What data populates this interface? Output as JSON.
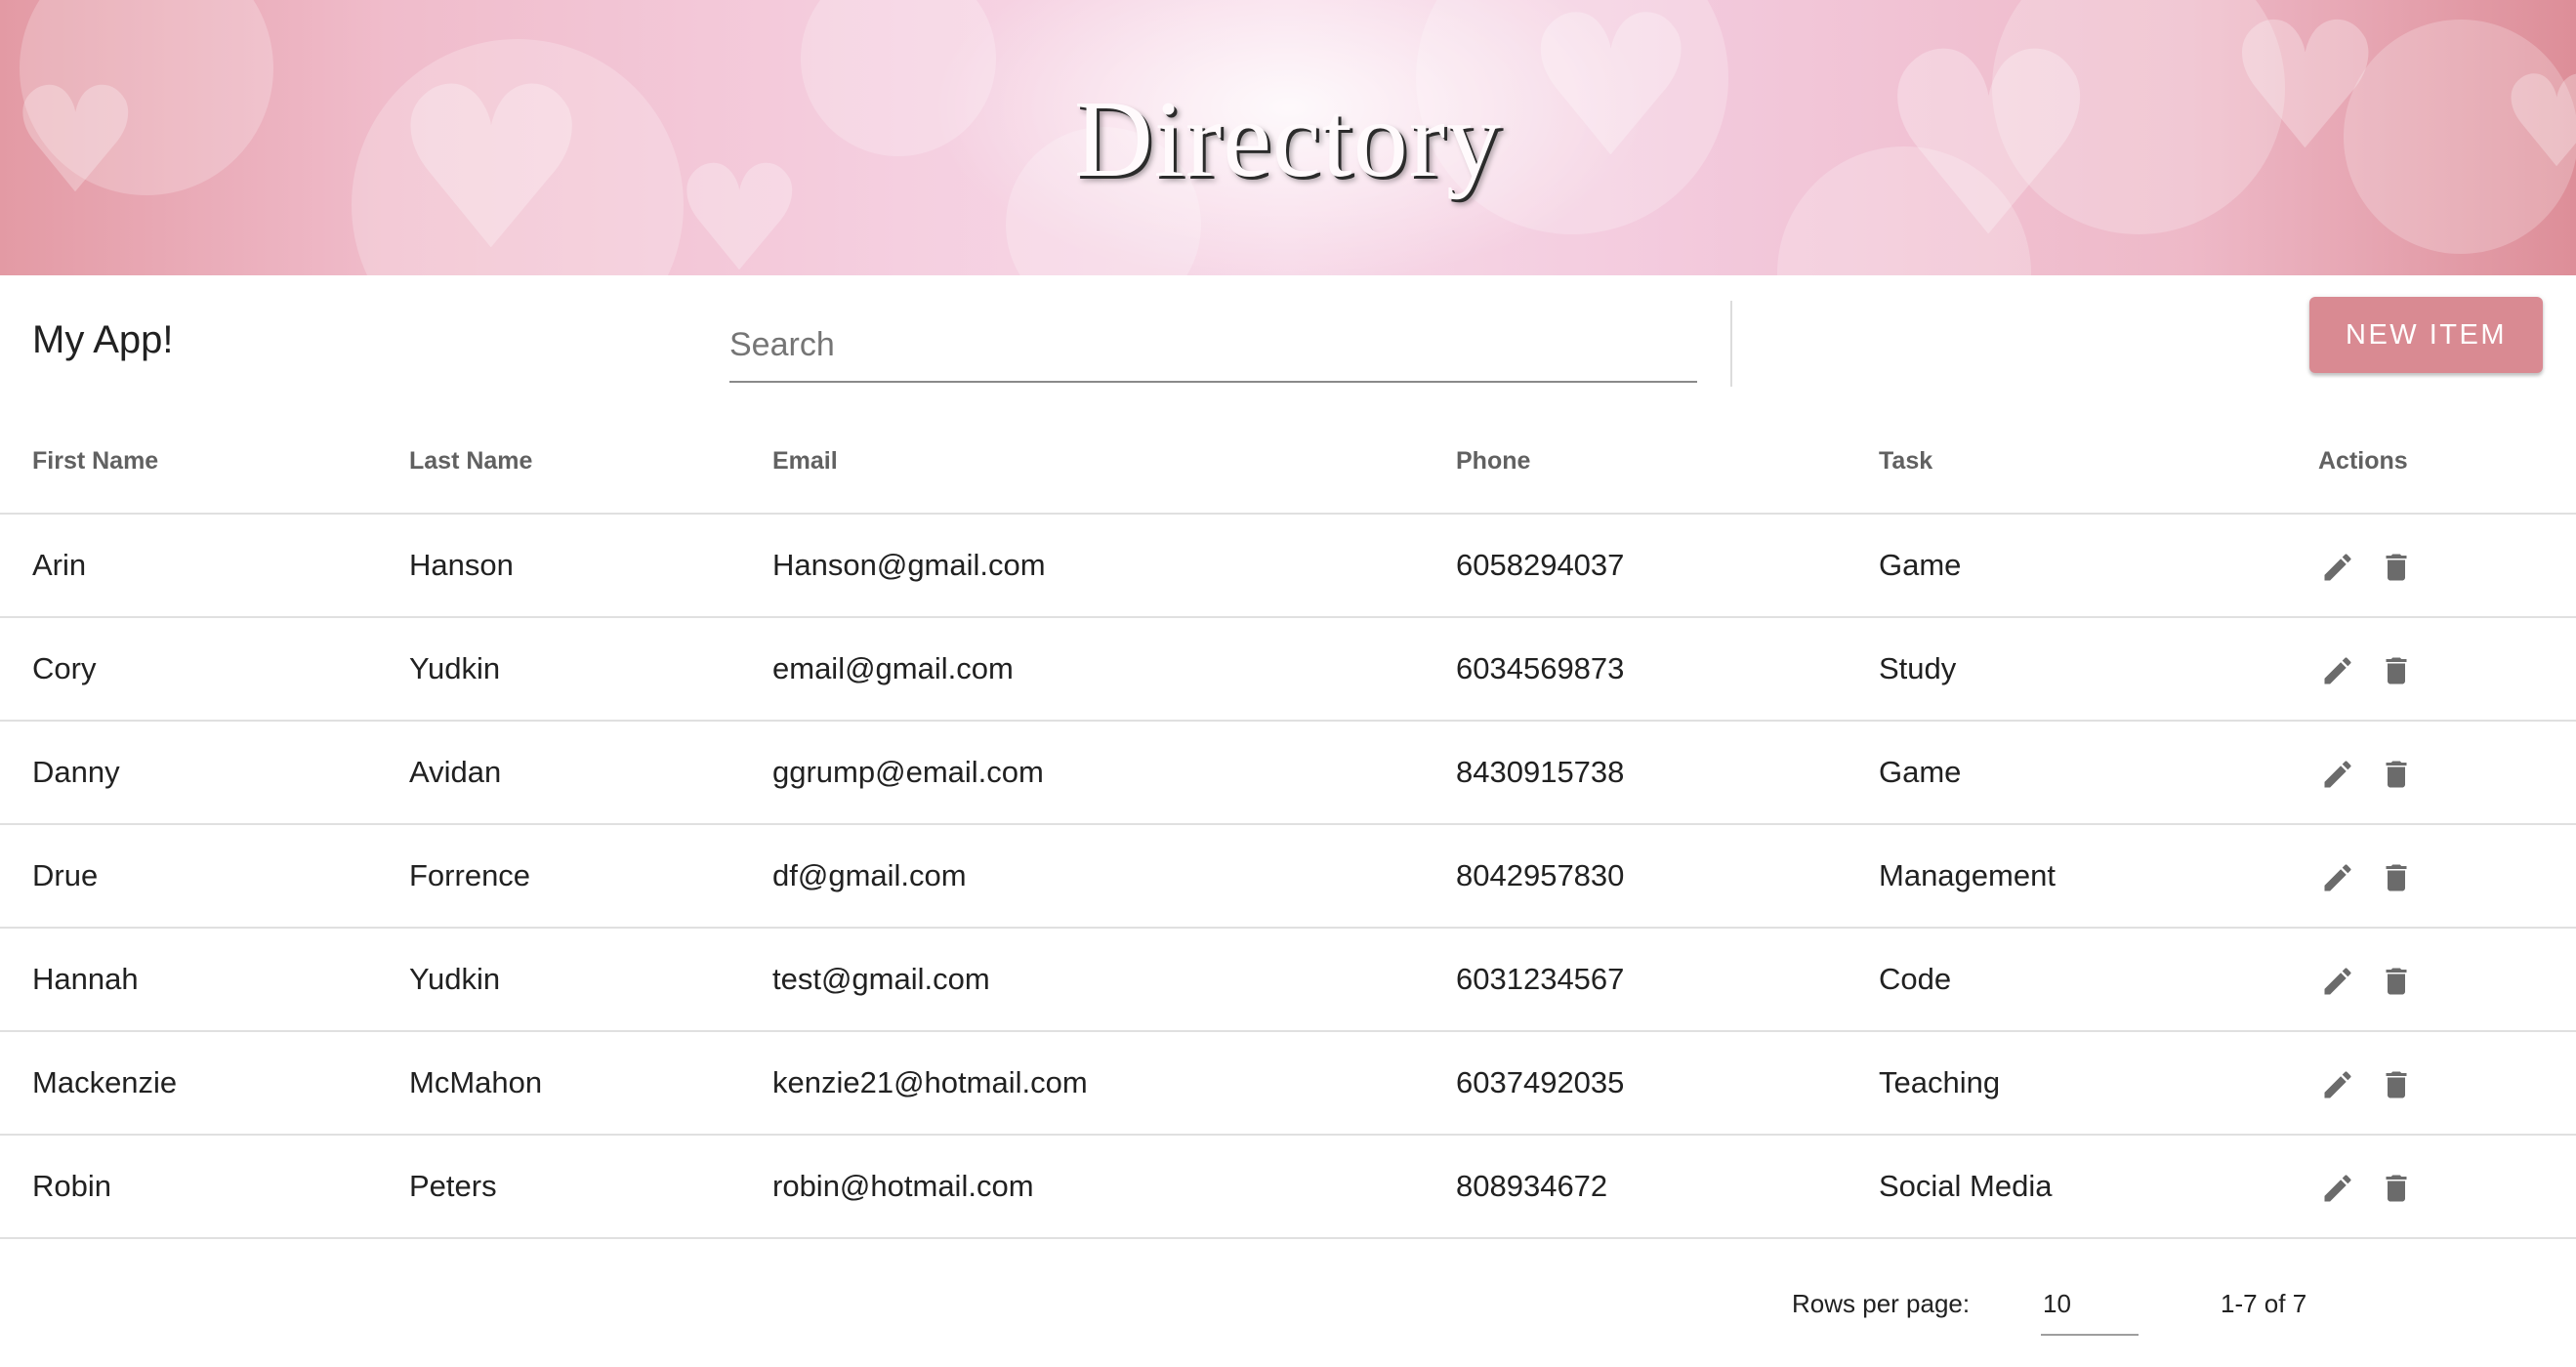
{
  "banner": {
    "title": "Directory"
  },
  "toolbar": {
    "app_title": "My App!",
    "search_placeholder": "Search",
    "search_value": "",
    "new_item_label": "NEW ITEM",
    "accent_color": "#d98a92"
  },
  "table": {
    "headers": {
      "first_name": "First Name",
      "last_name": "Last Name",
      "email": "Email",
      "phone": "Phone",
      "task": "Task",
      "actions": "Actions"
    },
    "rows": [
      {
        "first": "Arin",
        "last": "Hanson",
        "email": "Hanson@gmail.com",
        "phone": "6058294037",
        "task": "Game"
      },
      {
        "first": "Cory",
        "last": "Yudkin",
        "email": "email@gmail.com",
        "phone": "6034569873",
        "task": "Study"
      },
      {
        "first": "Danny",
        "last": "Avidan",
        "email": "ggrump@email.com",
        "phone": "8430915738",
        "task": "Game"
      },
      {
        "first": "Drue",
        "last": "Forrence",
        "email": "df@gmail.com",
        "phone": "8042957830",
        "task": "Management"
      },
      {
        "first": "Hannah",
        "last": "Yudkin",
        "email": "test@gmail.com",
        "phone": "6031234567",
        "task": "Code"
      },
      {
        "first": "Mackenzie",
        "last": "McMahon",
        "email": "kenzie21@hotmail.com",
        "phone": "6037492035",
        "task": "Teaching"
      },
      {
        "first": "Robin",
        "last": "Peters",
        "email": "robin@hotmail.com",
        "phone": "808934672",
        "task": "Social Media"
      }
    ],
    "row_action_icons": [
      "edit-icon",
      "delete-icon"
    ]
  },
  "pagination": {
    "rows_per_page_label": "Rows per page:",
    "rows_per_page_value": "10",
    "range_label": "1-7 of 7"
  }
}
